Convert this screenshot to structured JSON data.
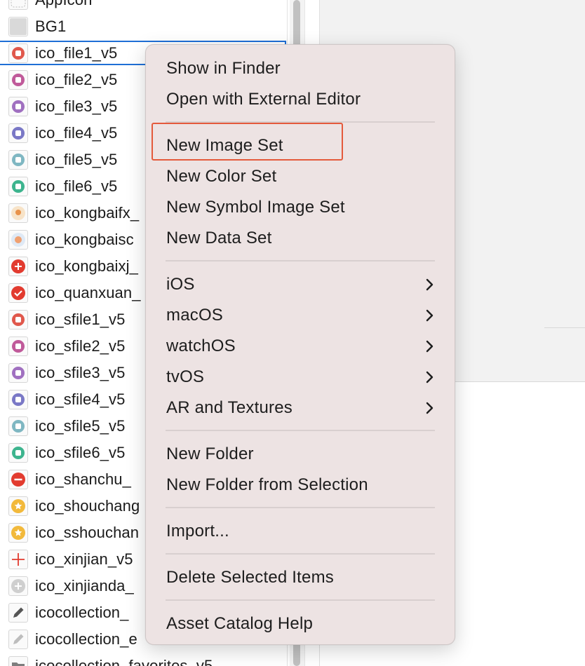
{
  "asset_list": {
    "items": [
      {
        "name": "AppIcon",
        "icon": "appicon-dashed-icon"
      },
      {
        "name": "BG1",
        "icon": "gray-square-icon"
      },
      {
        "name": "ico_file1_v5",
        "icon": "file-red-icon",
        "color": "#e0584c",
        "selected": true
      },
      {
        "name": "ico_file2_v5",
        "icon": "file-magenta-icon",
        "color": "#c05a9a"
      },
      {
        "name": "ico_file3_v5",
        "icon": "file-purple-icon",
        "color": "#a070c0"
      },
      {
        "name": "ico_file4_v5",
        "icon": "file-indigo-icon",
        "color": "#7a78c6"
      },
      {
        "name": "ico_file5_v5",
        "icon": "file-teal-icon",
        "color": "#7fb7c2"
      },
      {
        "name": "ico_file6_v5",
        "icon": "file-green-icon",
        "color": "#3db48e"
      },
      {
        "name": "ico_kongbaifx_",
        "icon": "empty-share-illustration-icon"
      },
      {
        "name": "ico_kongbaisc",
        "icon": "empty-collect-illustration-icon"
      },
      {
        "name": "ico_kongbaixj_",
        "icon": "plus-red-circle-icon",
        "color": "#e23b2f"
      },
      {
        "name": "ico_quanxuan_",
        "icon": "check-red-circle-icon",
        "color": "#e23b2f"
      },
      {
        "name": "ico_sfile1_v5",
        "icon": "sfile-red-icon",
        "color": "#e0584c"
      },
      {
        "name": "ico_sfile2_v5",
        "icon": "sfile-magenta-icon",
        "color": "#c05a9a"
      },
      {
        "name": "ico_sfile3_v5",
        "icon": "sfile-purple-icon",
        "color": "#a070c0"
      },
      {
        "name": "ico_sfile4_v5",
        "icon": "sfile-indigo-icon",
        "color": "#7a78c6"
      },
      {
        "name": "ico_sfile5_v5",
        "icon": "sfile-teal-icon",
        "color": "#7fb7c2"
      },
      {
        "name": "ico_sfile6_v5",
        "icon": "sfile-green-icon",
        "color": "#3db48e"
      },
      {
        "name": "ico_shanchu_",
        "icon": "minus-red-circle-icon",
        "color": "#e23b2f"
      },
      {
        "name": "ico_shouchang",
        "icon": "star-yellow-icon",
        "color": "#f2b93b"
      },
      {
        "name": "ico_sshouchan",
        "icon": "star-yellow-small-icon",
        "color": "#f2b93b"
      },
      {
        "name": "ico_xinjian_v5",
        "icon": "plus-red-icon",
        "color": "#e23b2f"
      },
      {
        "name": "ico_xinjianda_",
        "icon": "plus-gray-circle-icon",
        "color": "#cfcfcf"
      },
      {
        "name": "icocollection_",
        "icon": "pencil-dark-icon",
        "color": "#555555"
      },
      {
        "name": "icocollection_e",
        "icon": "pencil-light-icon",
        "color": "#bdbdbd"
      },
      {
        "name": "icocollection_favorites_v5",
        "icon": "folder-gray-icon",
        "color": "#7d7d7d"
      }
    ]
  },
  "context_menu": {
    "groups": [
      [
        "Show in Finder",
        "Open with External Editor"
      ],
      [
        "New Image Set",
        "New Color Set",
        "New Symbol Image Set",
        "New Data Set"
      ],
      [
        "iOS",
        "macOS",
        "watchOS",
        "tvOS",
        "AR and Textures"
      ],
      [
        "New Folder",
        "New Folder from Selection"
      ],
      [
        "Import..."
      ],
      [
        "Delete Selected Items"
      ],
      [
        "Asset Catalog Help"
      ]
    ],
    "submenu_items": [
      "iOS",
      "macOS",
      "watchOS",
      "tvOS",
      "AR and Textures"
    ],
    "highlighted_item": "New Image Set",
    "highlight_color": "#e45a3c"
  },
  "colors": {
    "selection_outline": "#1f6fd6",
    "menu_background": "#ede3e3"
  }
}
